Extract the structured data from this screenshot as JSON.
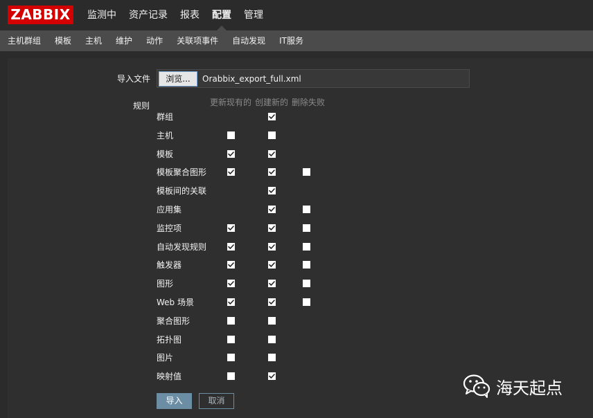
{
  "header": {
    "logo": "ZABBIX",
    "nav": [
      "监测中",
      "资产记录",
      "报表",
      "配置",
      "管理"
    ],
    "active_nav_index": 3
  },
  "subnav": [
    "主机群组",
    "模板",
    "主机",
    "维护",
    "动作",
    "关联项事件",
    "自动发现",
    "IT服务"
  ],
  "form": {
    "import_file_label": "导入文件",
    "browse_label": "浏览...",
    "file_name": "Orabbix_export_full.xml",
    "rules_label": "规则",
    "columns": [
      "更新现有的",
      "创建新的",
      "删除失败"
    ],
    "rules": [
      {
        "name": "群组",
        "update": null,
        "create": true,
        "delete": null
      },
      {
        "name": "主机",
        "update": false,
        "create": false,
        "delete": null
      },
      {
        "name": "模板",
        "update": true,
        "create": true,
        "delete": null
      },
      {
        "name": "模板聚合图形",
        "update": true,
        "create": true,
        "delete": false
      },
      {
        "name": "模板间的关联",
        "update": null,
        "create": true,
        "delete": null
      },
      {
        "name": "应用集",
        "update": null,
        "create": true,
        "delete": false
      },
      {
        "name": "监控项",
        "update": true,
        "create": true,
        "delete": false
      },
      {
        "name": "自动发现规则",
        "update": true,
        "create": true,
        "delete": false
      },
      {
        "name": "触发器",
        "update": true,
        "create": true,
        "delete": false
      },
      {
        "name": "图形",
        "update": true,
        "create": true,
        "delete": false
      },
      {
        "name": "Web 场景",
        "update": true,
        "create": true,
        "delete": false
      },
      {
        "name": "聚合图形",
        "update": false,
        "create": false,
        "delete": null
      },
      {
        "name": "拓扑图",
        "update": false,
        "create": false,
        "delete": null
      },
      {
        "name": "图片",
        "update": false,
        "create": false,
        "delete": null
      },
      {
        "name": "映射值",
        "update": false,
        "create": true,
        "delete": null
      }
    ],
    "import_button": "导入",
    "cancel_button": "取消"
  },
  "watermark": {
    "text": "海天起点",
    "icon": "wechat-icon"
  },
  "colors": {
    "logo_bg": "#d40000",
    "import_btn": "#6c8ea5",
    "background": "#2b2b2b",
    "subnav_bg": "#4b4b4b"
  }
}
